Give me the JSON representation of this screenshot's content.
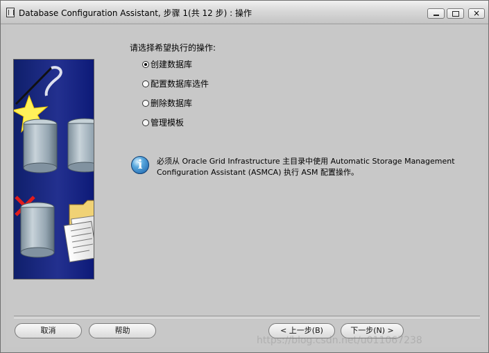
{
  "window": {
    "title": "Database Configuration Assistant, 步骤 1(共 12 步) : 操作"
  },
  "content": {
    "prompt": "请选择希望执行的操作:",
    "options": [
      {
        "label": "创建数据库",
        "selected": true
      },
      {
        "label": "配置数据库选件",
        "selected": false
      },
      {
        "label": "删除数据库",
        "selected": false
      },
      {
        "label": "管理模板",
        "selected": false
      }
    ],
    "info_line1": "必须从 Oracle Grid Infrastructure 主目录中使用 Automatic Storage Management",
    "info_line2": "Configuration Assistant (ASMCA) 执行 ASM 配置操作。"
  },
  "buttons": {
    "cancel": "取消",
    "help": "帮助",
    "back": "上一步(B)",
    "next": "下一步(N)"
  },
  "watermark": "https://blog.csdn.net/u011067238",
  "colors": {
    "window_bg": "#c7c7c7",
    "illustration_bg": "#23308f",
    "info_blue": "#185ea8"
  }
}
